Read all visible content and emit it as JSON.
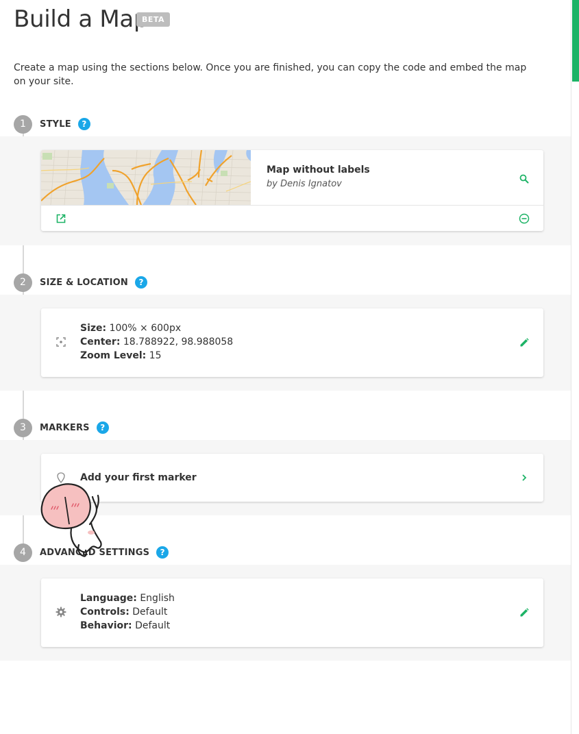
{
  "page": {
    "title": "Build a Map",
    "badge": "BETA",
    "intro": "Create a map using the sections below. Once you are finished, you can copy the code and embed the map on your site."
  },
  "steps": {
    "style": {
      "number": "1",
      "title": "STYLE",
      "help": "?"
    },
    "size": {
      "number": "2",
      "title": "SIZE & LOCATION",
      "help": "?"
    },
    "markers": {
      "number": "3",
      "title": "MARKERS",
      "help": "?"
    },
    "advanced": {
      "number": "4",
      "title": "ADVANCED SETTINGS",
      "help": "?"
    }
  },
  "style_card": {
    "name": "Map without labels",
    "author": "by Denis Ignatov",
    "icons": {
      "preview": "search-icon",
      "open": "external-link-icon",
      "remove": "minus-circle-icon"
    }
  },
  "size_card": {
    "size_label": "Size:",
    "size_value": " 100% × 600px",
    "center_label": "Center:",
    "center_value": " 18.788922, 98.988058",
    "zoom_label": "Zoom Level:",
    "zoom_value": " 15",
    "icons": {
      "row": "center-focus-icon",
      "edit": "pencil-icon"
    }
  },
  "markers_card": {
    "label": "Add your first marker",
    "icons": {
      "row": "map-pin-icon",
      "go": "chevron-right-icon"
    }
  },
  "advanced_card": {
    "language_label": "Language:",
    "language_value": " English",
    "controls_label": "Controls:",
    "controls_value": " Default",
    "behavior_label": "Behavior:",
    "behavior_value": " Default",
    "icons": {
      "row": "gear-icon",
      "edit": "pencil-icon"
    }
  },
  "colors": {
    "accent_green": "#1db366",
    "help_blue": "#1aa7e8",
    "step_gray": "#a6a6a6",
    "band_bg": "#f6f6f6"
  }
}
